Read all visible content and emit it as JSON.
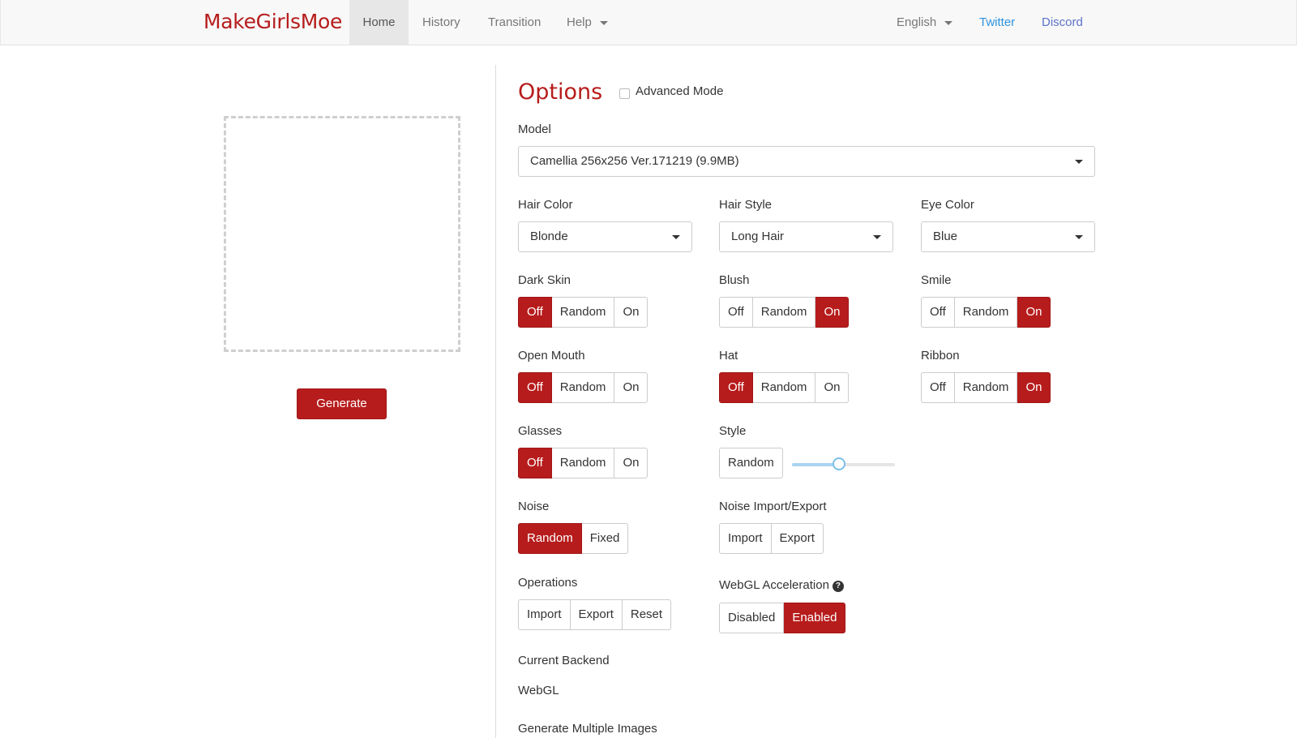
{
  "navbar": {
    "brand": "MakeGirlsMoe",
    "items": [
      {
        "label": "Home"
      },
      {
        "label": "History"
      },
      {
        "label": "Transition"
      },
      {
        "label": "Help"
      }
    ],
    "language": "English",
    "twitter": "Twitter",
    "discord": "Discord"
  },
  "left": {
    "generate_label": "Generate"
  },
  "options": {
    "title": "Options",
    "advanced_mode": "Advanced Mode",
    "model": {
      "label": "Model",
      "value": "Camellia 256x256 Ver.171219 (9.9MB)"
    },
    "hair_color": {
      "label": "Hair Color",
      "value": "Blonde"
    },
    "hair_style": {
      "label": "Hair Style",
      "value": "Long Hair"
    },
    "eye_color": {
      "label": "Eye Color",
      "value": "Blue"
    },
    "dark_skin": {
      "label": "Dark Skin",
      "off": "Off",
      "random": "Random",
      "on": "On",
      "selected": "off"
    },
    "blush": {
      "label": "Blush",
      "off": "Off",
      "random": "Random",
      "on": "On",
      "selected": "on"
    },
    "smile": {
      "label": "Smile",
      "off": "Off",
      "random": "Random",
      "on": "On",
      "selected": "on"
    },
    "open_mouth": {
      "label": "Open Mouth",
      "off": "Off",
      "random": "Random",
      "on": "On",
      "selected": "off"
    },
    "hat": {
      "label": "Hat",
      "off": "Off",
      "random": "Random",
      "on": "On",
      "selected": "off"
    },
    "ribbon": {
      "label": "Ribbon",
      "off": "Off",
      "random": "Random",
      "on": "On",
      "selected": "on"
    },
    "glasses": {
      "label": "Glasses",
      "off": "Off",
      "random": "Random",
      "on": "On",
      "selected": "off"
    },
    "style": {
      "label": "Style",
      "random": "Random",
      "slider_value": 0.46
    },
    "noise": {
      "label": "Noise",
      "random": "Random",
      "fixed": "Fixed",
      "selected": "random"
    },
    "noise_io": {
      "label": "Noise Import/Export",
      "import": "Import",
      "export": "Export"
    },
    "operations": {
      "label": "Operations",
      "import": "Import",
      "export": "Export",
      "reset": "Reset"
    },
    "webgl": {
      "label": "WebGL Acceleration",
      "disabled": "Disabled",
      "enabled": "Enabled",
      "selected": "enabled"
    },
    "current_backend": {
      "label": "Current Backend",
      "value": "WebGL"
    },
    "generate_multiple": {
      "label": "Generate Multiple Images"
    }
  },
  "colors": {
    "accent": "#b71c1c",
    "slider": "#7bbfe8"
  }
}
